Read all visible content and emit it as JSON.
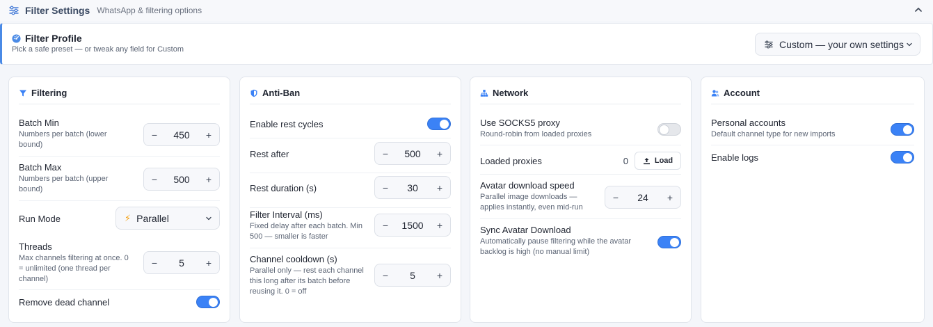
{
  "header": {
    "title": "Filter Settings",
    "subtitle": "WhatsApp & filtering options",
    "icon": "sliders-icon",
    "collapse_icon": "chevron-up-icon"
  },
  "profile": {
    "title": "Filter Profile",
    "subtitle": "Pick a safe preset — or tweak any field for Custom",
    "selected": "Custom — your own settings",
    "icon": "gauge-icon"
  },
  "panels": {
    "filtering": {
      "title": "Filtering",
      "batch_min": {
        "label": "Batch Min",
        "desc": "Numbers per batch (lower bound)",
        "value": "450"
      },
      "batch_max": {
        "label": "Batch Max",
        "desc": "Numbers per batch (upper bound)",
        "value": "500"
      },
      "run_mode": {
        "label": "Run Mode",
        "value": "Parallel"
      },
      "threads": {
        "label": "Threads",
        "desc": "Max channels filtering at once. 0 = unlimited (one thread per channel)",
        "value": "5"
      },
      "remove_dead": {
        "label": "Remove dead channel",
        "on": true
      }
    },
    "antiban": {
      "title": "Anti-Ban",
      "rest_cycles": {
        "label": "Enable rest cycles",
        "on": true
      },
      "rest_after": {
        "label": "Rest after",
        "value": "500"
      },
      "rest_duration": {
        "label": "Rest duration (s)",
        "value": "30"
      },
      "filter_interval": {
        "label": "Filter Interval (ms)",
        "desc": "Fixed delay after each batch. Min 500 — smaller is faster",
        "value": "1500"
      },
      "channel_cooldown": {
        "label": "Channel cooldown (s)",
        "desc": "Parallel only — rest each channel this long after its batch before reusing it. 0 = off",
        "value": "5"
      }
    },
    "network": {
      "title": "Network",
      "socks5": {
        "label": "Use SOCKS5 proxy",
        "desc": "Round-robin from loaded proxies",
        "on": false
      },
      "loaded_proxies": {
        "label": "Loaded proxies",
        "count": "0",
        "button": "Load"
      },
      "avatar_speed": {
        "label": "Avatar download speed",
        "desc": "Parallel image downloads — applies instantly, even mid-run",
        "value": "24"
      },
      "sync_avatar": {
        "label": "Sync Avatar Download",
        "desc": "Automatically pause filtering while the avatar backlog is high (no manual limit)",
        "on": true
      }
    },
    "account": {
      "title": "Account",
      "personal": {
        "label": "Personal accounts",
        "desc": "Default channel type for new imports",
        "on": true
      },
      "logs": {
        "label": "Enable logs",
        "on": true
      }
    }
  },
  "stepper": {
    "minus": "−",
    "plus": "+"
  },
  "colors": {
    "accent": "#3b82f6",
    "border": "#e1e5ec",
    "icon": "#4a8ae6"
  }
}
